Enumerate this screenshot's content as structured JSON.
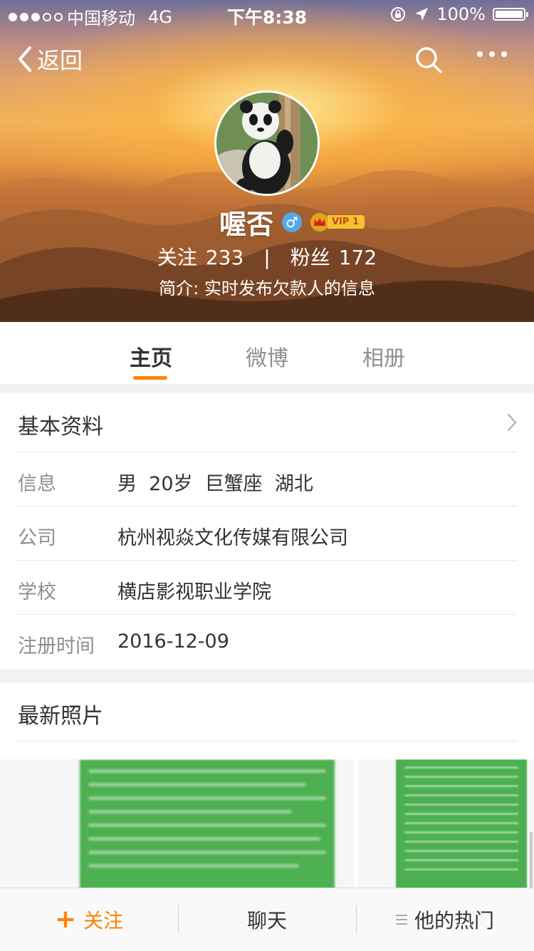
{
  "status_bar": {
    "carrier": "中国移动",
    "network": "4G",
    "time": "下午8:38",
    "battery": "100%",
    "battery_level": 1.0,
    "signal_bars": 3
  },
  "nav": {
    "back_label": "返回"
  },
  "profile": {
    "username": "喔否",
    "gender_symbol": "♂",
    "vip_label": "VIP 1",
    "following_label": "关注",
    "following_count": "233",
    "separator": "|",
    "followers_label": "粉丝",
    "followers_count": "172",
    "bio": "简介: 实时发布欠款人的信息"
  },
  "tabs": [
    {
      "label": "主页",
      "active": true
    },
    {
      "label": "微博",
      "active": false
    },
    {
      "label": "相册",
      "active": false
    }
  ],
  "basic_info": {
    "title": "基本资料",
    "rows": [
      {
        "label": "信息",
        "value": "男  20岁  巨蟹座  湖北"
      },
      {
        "label": "公司",
        "value": "杭州视焱文化传媒有限公司"
      },
      {
        "label": "学校",
        "value": "横店影视职业学院"
      },
      {
        "label": "注册时间",
        "value": "2016-12-09"
      }
    ]
  },
  "photos": {
    "title": "最新照片"
  },
  "bottom_bar": {
    "follow_icon": "+",
    "follow_label": "关注",
    "chat_label": "聊天",
    "hot_label": "他的热门"
  },
  "colors": {
    "accent": "#ff8200",
    "photo_green": "#4caf50",
    "gender_blue": "#55a8e8"
  }
}
